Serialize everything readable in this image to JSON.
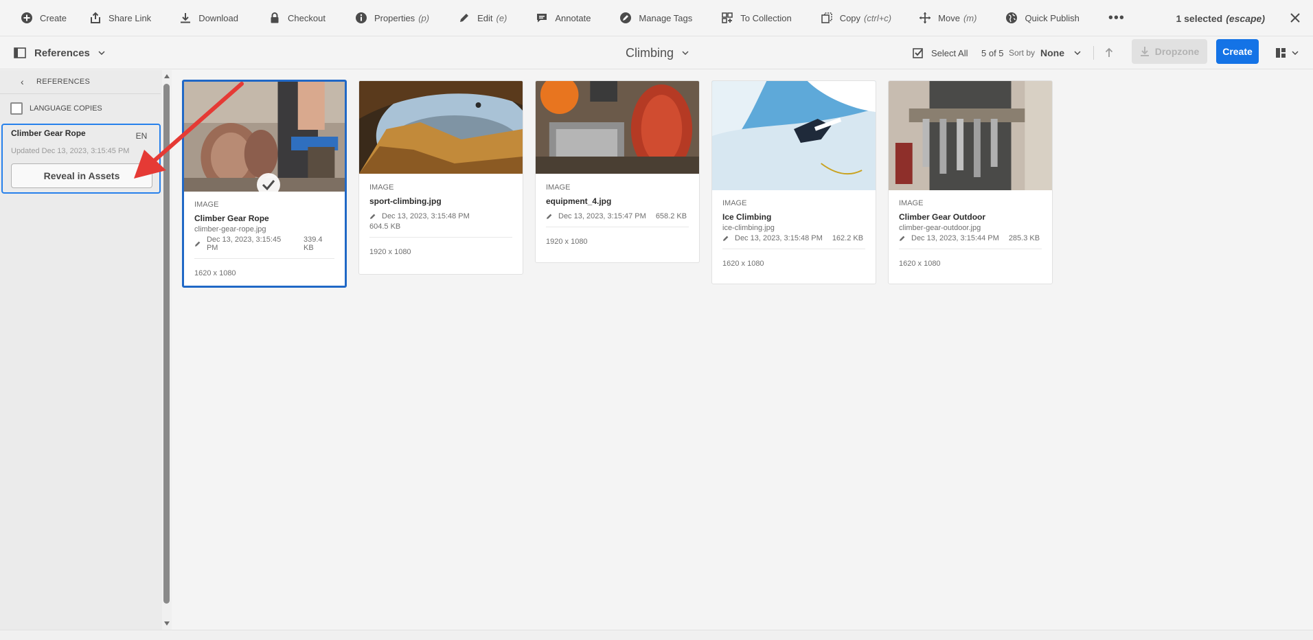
{
  "actionbar": {
    "actions": [
      {
        "label": "Create",
        "shortcut": ""
      },
      {
        "label": "Share Link",
        "shortcut": ""
      },
      {
        "label": "Download",
        "shortcut": ""
      },
      {
        "label": "Checkout",
        "shortcut": ""
      },
      {
        "label": "Properties",
        "shortcut": "(p)"
      },
      {
        "label": "Edit",
        "shortcut": "(e)"
      },
      {
        "label": "Annotate",
        "shortcut": ""
      },
      {
        "label": "Manage Tags",
        "shortcut": ""
      },
      {
        "label": "To Collection",
        "shortcut": ""
      },
      {
        "label": "Copy",
        "shortcut": "(ctrl+c)"
      },
      {
        "label": "Move",
        "shortcut": "(m)"
      },
      {
        "label": "Quick Publish",
        "shortcut": ""
      }
    ],
    "more_label": "•••",
    "selection_text": "1 selected",
    "selection_shortcut": "(escape)"
  },
  "header": {
    "rail_label": "References",
    "folder_title": "Climbing",
    "select_all": "Select All",
    "count": "5 of 5",
    "sort_by_label": "Sort by",
    "sort_by_value": "None",
    "dropzone_label": "Dropzone",
    "create_label": "Create"
  },
  "rail": {
    "header": "REFERENCES",
    "language_copies": "LANGUAGE COPIES",
    "reference": {
      "title": "Climber Gear Rope",
      "lang": "EN",
      "updated": "Updated Dec 13, 2023, 3:15:45 PM",
      "reveal_label": "Reveal in Assets"
    }
  },
  "cards": [
    {
      "type": "IMAGE",
      "title": "Climber Gear Rope",
      "file": "climber-gear-rope.jpg",
      "date": "Dec 13, 2023, 3:15:45 PM",
      "size": "339.4 KB",
      "dims": "1620 x 1080"
    },
    {
      "type": "IMAGE",
      "title": "sport-climbing.jpg",
      "file": "",
      "date": "Dec 13, 2023, 3:15:48 PM",
      "size": "604.5 KB",
      "dims": "1920 x 1080"
    },
    {
      "type": "IMAGE",
      "title": "equipment_4.jpg",
      "file": "",
      "date": "Dec 13, 2023, 3:15:47 PM",
      "size": "658.2 KB",
      "dims": "1920 x 1080"
    },
    {
      "type": "IMAGE",
      "title": "Ice Climbing",
      "file": "ice-climbing.jpg",
      "date": "Dec 13, 2023, 3:15:48 PM",
      "size": "162.2 KB",
      "dims": "1620 x 1080"
    },
    {
      "type": "IMAGE",
      "title": "Climber Gear Outdoor",
      "file": "climber-gear-outdoor.jpg",
      "date": "Dec 13, 2023, 3:15:44 PM",
      "size": "285.3 KB",
      "dims": "1620 x 1080"
    }
  ],
  "colors": {
    "accent": "#1473e6",
    "selection_border": "#2068c6",
    "annotation": "#e53a35"
  }
}
